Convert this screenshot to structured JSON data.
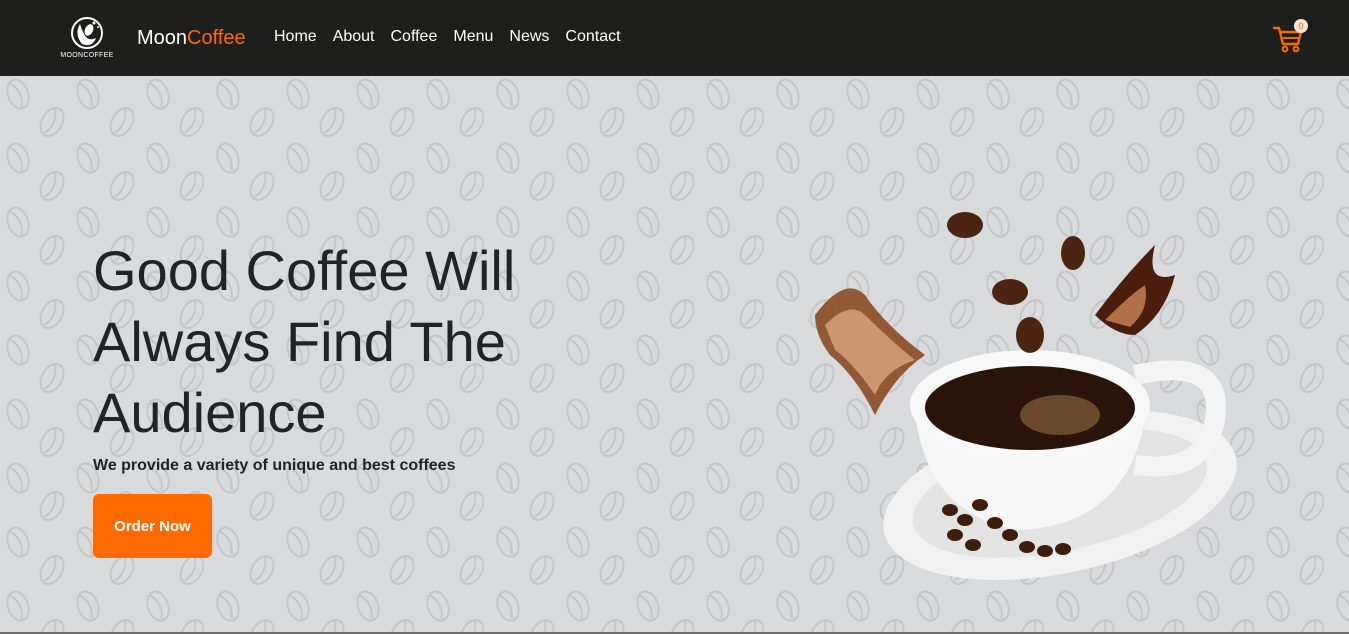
{
  "nav": {
    "logo_text": "MOONCOFFEE",
    "brand_primary": "Moon",
    "brand_accent": "Coffee",
    "links": [
      "Home",
      "About",
      "Coffee",
      "Menu",
      "News",
      "Contact"
    ],
    "cart_count": "0",
    "cart_icon": "shopping-cart-icon"
  },
  "hero": {
    "headline_line1": "Good Coffee Will",
    "headline_line2": "Always Find The",
    "headline_line3": "Audience",
    "subtext": "We provide a variety of unique and best coffees",
    "cta_label": "Order Now",
    "image": "coffee-cup-splash-illustration",
    "background": "coffee-bean-pattern"
  },
  "colors": {
    "accent": "#ff6a00",
    "nav_background": "#1e1f1d",
    "hero_background": "#d9dadb",
    "text_dark": "#222325"
  }
}
